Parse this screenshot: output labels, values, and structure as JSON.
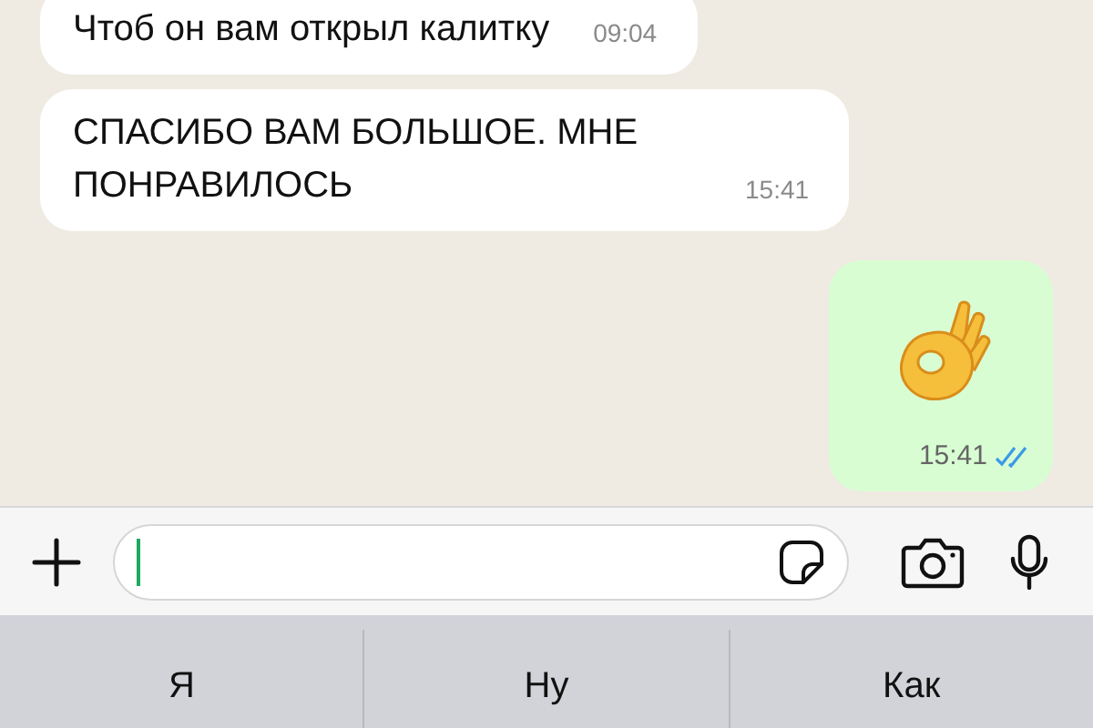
{
  "messages": [
    {
      "kind": "text",
      "outgoing": false,
      "text": "Чтоб он вам открыл калитку",
      "time": "09:04"
    },
    {
      "kind": "text",
      "outgoing": false,
      "text": "СПАСИБО ВАМ БОЛЬШОЕ. МНЕ ПОНРАВИЛОСЬ",
      "time": "15:41"
    },
    {
      "kind": "emoji",
      "outgoing": true,
      "time": "15:41",
      "read": true
    }
  ],
  "suggestions": [
    {
      "text": "Я"
    },
    {
      "text": "Ну"
    },
    {
      "text": "Как"
    }
  ]
}
